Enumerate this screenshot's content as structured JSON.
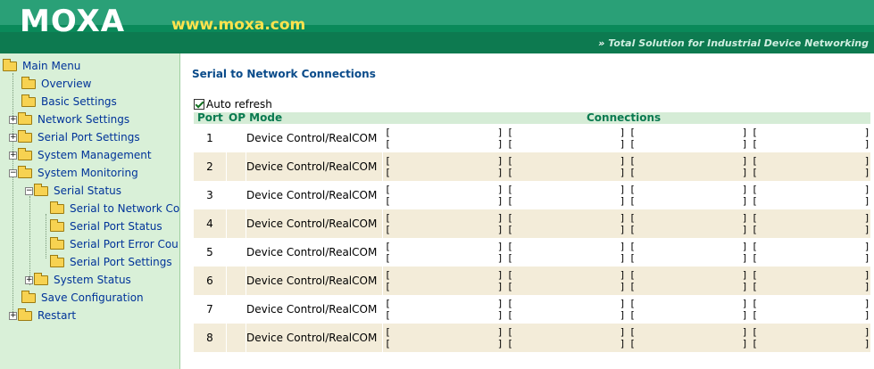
{
  "header": {
    "logo": "MOXA",
    "url": "www.moxa.com",
    "tagline_arrows": "»",
    "tagline": "Total Solution for Industrial Device Networking"
  },
  "sidebar": {
    "items": [
      {
        "label": "Main Menu"
      },
      {
        "label": "Overview"
      },
      {
        "label": "Basic Settings"
      },
      {
        "label": "Network Settings"
      },
      {
        "label": "Serial Port Settings"
      },
      {
        "label": "System Management"
      },
      {
        "label": "System Monitoring"
      },
      {
        "label": "Serial Status"
      },
      {
        "label": "Serial to Network Co"
      },
      {
        "label": "Serial Port Status"
      },
      {
        "label": "Serial Port Error Cou"
      },
      {
        "label": "Serial Port Settings"
      },
      {
        "label": "System Status"
      },
      {
        "label": "Save Configuration"
      },
      {
        "label": "Restart"
      }
    ]
  },
  "main": {
    "title": "Serial to Network Connections",
    "auto_refresh_label": "Auto refresh",
    "auto_refresh_checked": true,
    "table": {
      "headers": {
        "port": "Port",
        "mode": "OP Mode",
        "connections": "Connections"
      },
      "bracket_open": "[",
      "bracket_close": "]",
      "rows": [
        {
          "port": "1",
          "mode": "Device Control/RealCOM"
        },
        {
          "port": "2",
          "mode": "Device Control/RealCOM"
        },
        {
          "port": "3",
          "mode": "Device Control/RealCOM"
        },
        {
          "port": "4",
          "mode": "Device Control/RealCOM"
        },
        {
          "port": "5",
          "mode": "Device Control/RealCOM"
        },
        {
          "port": "6",
          "mode": "Device Control/RealCOM"
        },
        {
          "port": "7",
          "mode": "Device Control/RealCOM"
        },
        {
          "port": "8",
          "mode": "Device Control/RealCOM"
        }
      ]
    }
  },
  "colors": {
    "header_green": "#0a8a5a",
    "sidebar_bg": "#d9f0d8",
    "row_alt": "#f3ecd9",
    "header_row": "#d5ecd6",
    "link_blue": "#003399",
    "title_blue": "#0a4b8a"
  }
}
